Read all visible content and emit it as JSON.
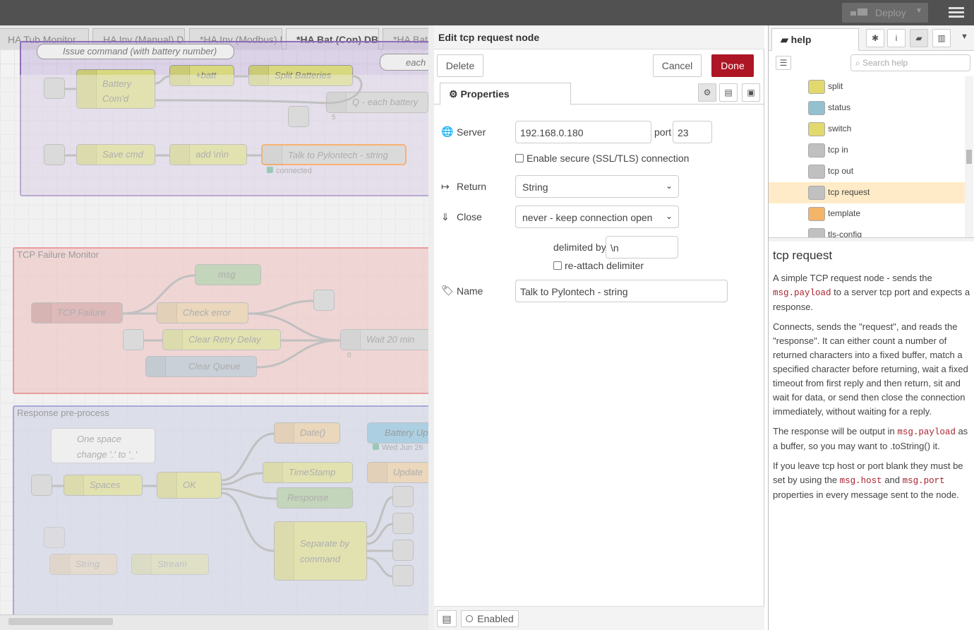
{
  "header": {
    "deploy_label": "Deploy"
  },
  "workspace": {
    "tabs": [
      "HA Tub Monitor",
      "HA Inv (Manual) DB",
      "*HA Inv (Modbus) DB",
      "*HA Bat (Con) DB",
      "*HA Bat"
    ],
    "groups": {
      "tcp_failure": "TCP Failure Monitor",
      "response": "Response pre-process"
    },
    "nodes": {
      "issue_cmd": "Issue command (with battery number)",
      "battery_cmd": "Battery Com'd",
      "batt": "+batt",
      "split_batteries": "Split Batteries",
      "q_each": "Q - each battery",
      "q_count": "5",
      "each": "each",
      "save_cmd": "Save cmd",
      "add_nn": "add \\n\\n",
      "talk": "Talk to Pylontech - string",
      "connected": "connected",
      "msg": "msg",
      "tcp_failure": "TCP Failure",
      "check_error": "Check error",
      "clear_retry": "Clear Retry Delay",
      "wait": "Wait 20 min",
      "wait_count": "0",
      "clear_queue": "Clear Queue",
      "comment1": "One space change '.' to '_'",
      "date": "Date()",
      "battery_up": "Battery Up",
      "wed": "Wed Jun 26",
      "spaces": "Spaces",
      "ok": "OK",
      "timestamp": "TimeStamp",
      "update": "Update",
      "response": "Response",
      "separate": "Separate by command",
      "string": "String",
      "stream": "Stream"
    }
  },
  "editor": {
    "title": "Edit tcp request node",
    "delete_label": "Delete",
    "cancel_label": "Cancel",
    "done_label": "Done",
    "properties_tab": "Properties",
    "server_label": "Server",
    "server_value": "192.168.0.180",
    "port_label": "port",
    "port_value": "23",
    "ssl_label": "Enable secure (SSL/TLS) connection",
    "return_label": "Return",
    "return_value": "String",
    "close_label": "Close",
    "close_value": "never - keep connection open",
    "delimited_label": "delimited by",
    "delimited_value": "\\n",
    "reattach_label": "re-attach delimiter",
    "name_label": "Name",
    "name_value": "Talk to Pylontech - string",
    "enabled_label": "Enabled"
  },
  "sidebar": {
    "tab_label": "help",
    "search_placeholder": "Search help",
    "palette": [
      {
        "name": "split",
        "color": "#e2d96e"
      },
      {
        "name": "status",
        "color": "#94c1d0"
      },
      {
        "name": "switch",
        "color": "#e2d96e"
      },
      {
        "name": "tcp in",
        "color": "#c0c0c0"
      },
      {
        "name": "tcp out",
        "color": "#c0c0c0"
      },
      {
        "name": "tcp request",
        "color": "#c0c0c0"
      },
      {
        "name": "template",
        "color": "#f3b567"
      },
      {
        "name": "tls-config",
        "color": "#c0c0c0"
      }
    ],
    "help": {
      "title": "tcp request",
      "p1_a": "A simple TCP request node - sends the ",
      "p1_code": "msg.payload",
      "p1_b": " to a server tcp port and expects a response.",
      "p2": "Connects, sends the \"request\", and reads the \"response\". It can either count a number of returned characters into a fixed buffer, match a specified character before returning, wait a fixed timeout from first reply and then return, sit and wait for data, or send then close the connection immediately, without waiting for a reply.",
      "p3_a": "The response will be output in ",
      "p3_code": "msg.payload",
      "p3_b": " as a buffer, so you may want to .toString() it.",
      "p4_a": "If you leave tcp host or port blank they must be set by using the ",
      "p4_code1": "msg.host",
      "p4_and": " and ",
      "p4_code2": "msg.port",
      "p4_b": " properties in every message sent to the node."
    }
  }
}
